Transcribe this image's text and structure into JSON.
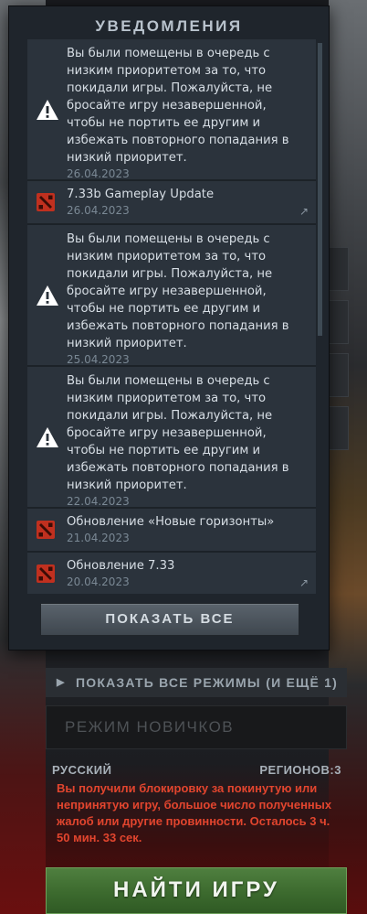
{
  "notifications_panel": {
    "title": "УВЕДОМЛЕНИЯ",
    "show_all_label": "ПОКАЗАТЬ ВСЕ",
    "items": [
      {
        "type": "warning",
        "icon": "warning-icon",
        "text": "Вы были помещены в очередь с низким приоритетом за то, что покидали игры. Пожалуйста, не бросайте игру незавершенной, чтобы не портить ее другим и избежать повторного попадания в низкий приоритет.",
        "date": "26.04.2023"
      },
      {
        "type": "update",
        "icon": "dota-logo-icon",
        "text": "7.33b Gameplay Update",
        "date": "26.04.2023"
      },
      {
        "type": "warning",
        "icon": "warning-icon",
        "text": "Вы были помещены в очередь с низким приоритетом за то, что покидали игры. Пожалуйста, не бросайте игру незавершенной, чтобы не портить ее другим и избежать повторного попадания в низкий приоритет.",
        "date": "25.04.2023"
      },
      {
        "type": "warning",
        "icon": "warning-icon",
        "text": "Вы были помещены в очередь с низким приоритетом за то, что покидали игры. Пожалуйста, не бросайте игру незавершенной, чтобы не портить ее другим и избежать повторного попадания в низкий приоритет.",
        "date": "22.04.2023"
      },
      {
        "type": "update",
        "icon": "dota-logo-icon",
        "text": "Обновление «Новые горизонты»",
        "date": "21.04.2023"
      },
      {
        "type": "update",
        "icon": "dota-logo-icon",
        "text": "Обновление 7.33",
        "date": "20.04.2023"
      }
    ]
  },
  "play_panel": {
    "show_modes_label": "ПОКАЗАТЬ ВСЕ РЕЖИМЫ",
    "more_count_label": "(И ЕЩЁ 1)",
    "mode_label": "РЕЖИМ НОВИЧКОВ",
    "language_label": "РУССКИЙ",
    "regions_label": "РЕГИОНОВ:3",
    "ban_message": "Вы получили блокировку за покинутую или непринятую игру, большое число полученных жалоб или другие провинности. Осталось 3 ч. 50 мин. 33 сек.",
    "find_game_label": "НАЙТИ ИГРУ"
  },
  "colors": {
    "panel_bg": "#1f252c",
    "item_bg": "#2b333c",
    "ban_text": "#e2452e",
    "find_button": "#3c6a2e",
    "dota_red": "#c0301f"
  }
}
